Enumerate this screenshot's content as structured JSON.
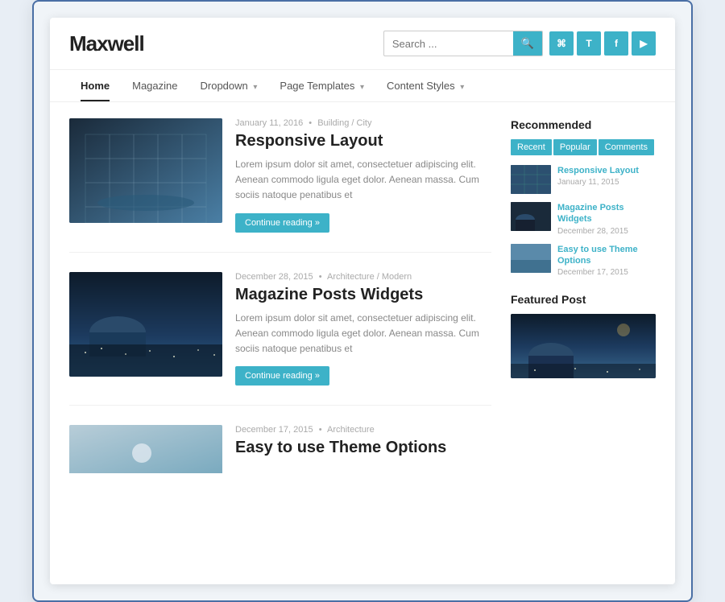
{
  "site": {
    "logo": "Maxwell",
    "search_placeholder": "Search ...",
    "search_btn_label": "🔍"
  },
  "social": [
    {
      "label": "RSS",
      "icon": "rss-icon"
    },
    {
      "label": "T",
      "icon": "twitter-icon"
    },
    {
      "label": "f",
      "icon": "facebook-icon"
    },
    {
      "label": "▶",
      "icon": "youtube-icon"
    }
  ],
  "nav": {
    "items": [
      {
        "label": "Home",
        "active": true
      },
      {
        "label": "Magazine",
        "active": false
      },
      {
        "label": "Dropdown",
        "has_arrow": true
      },
      {
        "label": "Page Templates",
        "has_arrow": true
      },
      {
        "label": "Content Styles",
        "has_arrow": true
      }
    ]
  },
  "posts": [
    {
      "date": "January 11, 2016",
      "category": "Building / City",
      "title": "Responsive Layout",
      "excerpt": "Lorem ipsum dolor sit amet, consectetuer adipiscing elit. Aenean commodo ligula eget dolor. Aenean massa. Cum sociis natoque penatibus et",
      "read_more": "Continue reading »",
      "thumb_type": "building"
    },
    {
      "date": "December 28, 2015",
      "category": "Architecture / Modern",
      "title": "Magazine Posts Widgets",
      "excerpt": "Lorem ipsum dolor sit amet, consectetuer adipiscing elit. Aenean commodo ligula eget dolor. Aenean massa. Cum sociis natoque penatibus et",
      "read_more": "Continue reading »",
      "thumb_type": "city"
    },
    {
      "date": "December 17, 2015",
      "category": "Architecture",
      "title": "Easy to use Theme Options",
      "excerpt": "",
      "read_more": "",
      "thumb_type": "partial"
    }
  ],
  "sidebar": {
    "recommended_title": "Recommended",
    "tabs": [
      "Recent",
      "Popular",
      "Comments"
    ],
    "items": [
      {
        "title": "Responsive Layout",
        "date": "January 11, 2015",
        "thumb_type": "rec-thumb-1"
      },
      {
        "title": "Magazine Posts Widgets",
        "date": "December 28, 2015",
        "thumb_type": "rec-thumb-2"
      },
      {
        "title": "Easy to use Theme Options",
        "date": "December 17, 2015",
        "thumb_type": "rec-thumb-3"
      }
    ],
    "featured_title": "Featured Post"
  }
}
